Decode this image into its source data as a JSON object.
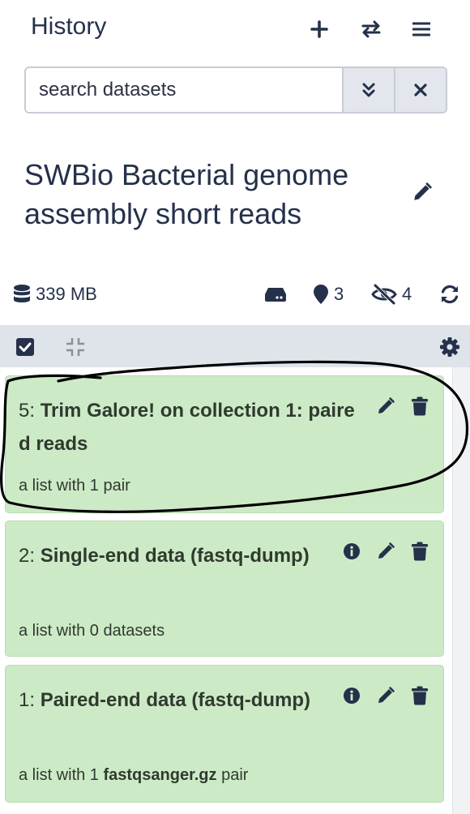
{
  "header": {
    "title": "History"
  },
  "search": {
    "placeholder": "search datasets"
  },
  "history": {
    "name": "SWBio Bacterial genome assembly short reads"
  },
  "stats": {
    "size": "339 MB",
    "shown_count": "3",
    "hidden_count": "4"
  },
  "items": [
    {
      "hid": "5:",
      "name": "Trim Galore! on collection 1: paired reads",
      "subtitle_prefix": "a list with 1 pair",
      "subtitle_bold": "",
      "subtitle_suffix": ""
    },
    {
      "hid": "2:",
      "name": "Single-end data (fastq-dump)",
      "subtitle_prefix": "a list with 0 datasets",
      "subtitle_bold": "",
      "subtitle_suffix": ""
    },
    {
      "hid": "1:",
      "name": "Paired-end data (fastq-dump)",
      "subtitle_prefix": "a list with 1 ",
      "subtitle_bold": "fastqsanger.gz",
      "subtitle_suffix": " pair"
    }
  ],
  "colors": {
    "item_background": "#cdeac6",
    "toolbar_background": "#dfe3ea",
    "icon_color": "#25314a"
  }
}
